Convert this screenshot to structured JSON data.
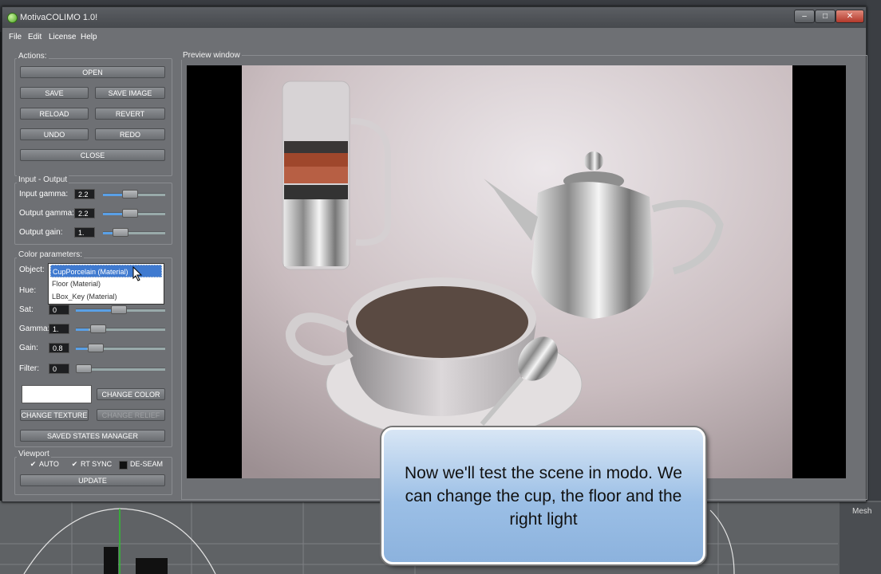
{
  "window": {
    "title": "MotivaCOLIMO 1.0!"
  },
  "menu": [
    "File",
    "Edit",
    "License",
    "Help"
  ],
  "actions": {
    "label": "Actions:",
    "open": "OPEN",
    "save": "SAVE",
    "save_image": "SAVE IMAGE",
    "reload": "RELOAD",
    "revert": "REVERT",
    "undo": "UNDO",
    "redo": "REDO",
    "close": "CLOSE"
  },
  "io": {
    "label": "Input - Output",
    "input_gamma_label": "Input gamma:",
    "input_gamma": "2.2",
    "output_gamma_label": "Output gamma:",
    "output_gamma": "2.2",
    "output_gain_label": "Output gain:",
    "output_gain": "1."
  },
  "color": {
    "label": "Color parameters:",
    "object_label": "Object:",
    "object_options": [
      "CupPorcelain (Material)",
      "Floor (Material)",
      "LBox_Key (Material)"
    ],
    "hue_label": "Hue:",
    "sat_label": "Sat:",
    "sat": "0",
    "gamma_label": "Gamma:",
    "gamma": "1.",
    "gain_label": "Gain:",
    "gain": "0.8",
    "filter_label": "Filter:",
    "filter": "0",
    "change_color": "CHANGE COLOR",
    "change_texture": "CHANGE TEXTURE",
    "change_relief": "CHANGE RELIEF",
    "saved_states": "SAVED STATES MANAGER"
  },
  "viewport": {
    "label": "Viewport",
    "auto": "AUTO",
    "rt_sync": "RT SYNC",
    "de_seam": "DE-SEAM",
    "update": "UPDATE"
  },
  "preview": {
    "label": "Preview window"
  },
  "callout": {
    "text": "Now we'll test the scene in modo. We can change the cup, the floor and the right light"
  },
  "modo": {
    "mesh_label": "Mesh"
  }
}
